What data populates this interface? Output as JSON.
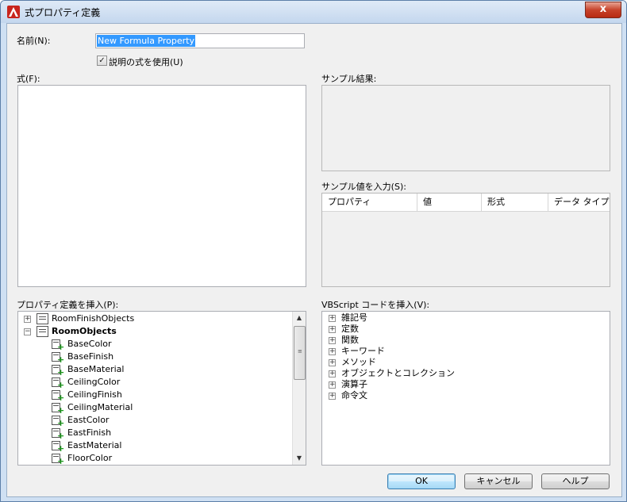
{
  "window": {
    "title": "式プロパティ定義",
    "close_label": "x"
  },
  "form": {
    "name_label": "名前(N):",
    "name_value": "New Formula Property",
    "checkbox_label": "説明の式を使用(U)",
    "checkbox_checked": true,
    "formula_label": "式(F):",
    "sample_result_label": "サンプル結果:",
    "sample_input_label": "サンプル値を入力(S):",
    "sample_grid_columns": [
      "プロパティ",
      "値",
      "形式",
      "データ タイプ"
    ],
    "insert_property_label": "プロパティ定義を挿入(P):",
    "insert_vbscript_label": "VBScript コードを挿入(V):"
  },
  "property_tree": {
    "groups": [
      {
        "label": "RoomFinishObjects",
        "expanded": false,
        "bold": false
      },
      {
        "label": "RoomObjects",
        "expanded": true,
        "bold": true
      }
    ],
    "children": [
      "BaseColor",
      "BaseFinish",
      "BaseMaterial",
      "CeilingColor",
      "CeilingFinish",
      "CeilingMaterial",
      "EastColor",
      "EastFinish",
      "EastMaterial",
      "FloorColor"
    ]
  },
  "vbscript_tree": [
    "雑記号",
    "定数",
    "関数",
    "キーワード",
    "メソッド",
    "オブジェクトとコレクション",
    "演算子",
    "命令文"
  ],
  "buttons": {
    "ok": "OK",
    "cancel": "キャンセル",
    "help": "ヘルプ"
  },
  "colors": {
    "selection": "#3399ff",
    "title_bg": "#c4d7ee",
    "close": "#c7432b",
    "add_green": "#1f9a1f"
  }
}
